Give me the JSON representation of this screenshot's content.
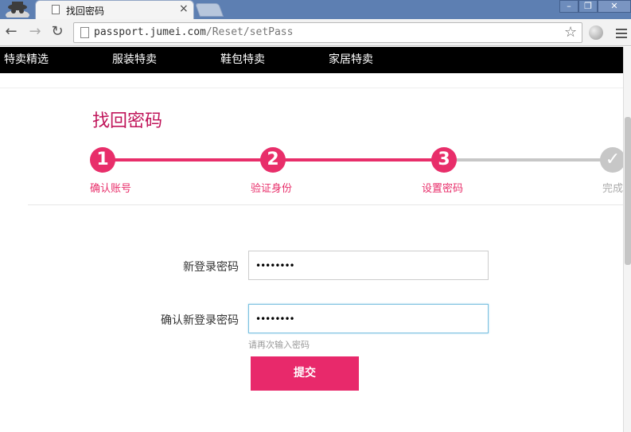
{
  "browser": {
    "tab_title": "找回密码",
    "tab_close": "×",
    "url_host": "passport.jumei.com",
    "url_path": "/Reset/setPass",
    "window_min": "–",
    "window_max": "❐",
    "window_close": "✕"
  },
  "site_nav": [
    {
      "label": "特卖精选"
    },
    {
      "label": "服装特卖"
    },
    {
      "label": "鞋包特卖"
    },
    {
      "label": "家居特卖"
    }
  ],
  "page": {
    "title": "找回密码",
    "steps": [
      {
        "number": "1",
        "label": "确认账号",
        "state": "done"
      },
      {
        "number": "2",
        "label": "验证身份",
        "state": "done"
      },
      {
        "number": "3",
        "label": "设置密码",
        "state": "current"
      },
      {
        "number": "✓",
        "label": "完成",
        "state": "pending"
      }
    ],
    "new_password_label": "新登录密码",
    "new_password_value": "••••••••",
    "confirm_password_label": "确认新登录密码",
    "confirm_password_value": "••••••••",
    "hint": "请再次输入密码",
    "submit_label": "提交"
  },
  "colors": {
    "accent": "#e82e6a",
    "title": "#c0155a",
    "nav_bg": "#000000",
    "inactive": "#c7c7c7"
  },
  "icons": [
    "incognito-icon",
    "page-icon",
    "back-icon",
    "forward-icon",
    "reload-icon",
    "bookmark-star-icon",
    "globe-icon",
    "menu-icon",
    "check-icon"
  ]
}
